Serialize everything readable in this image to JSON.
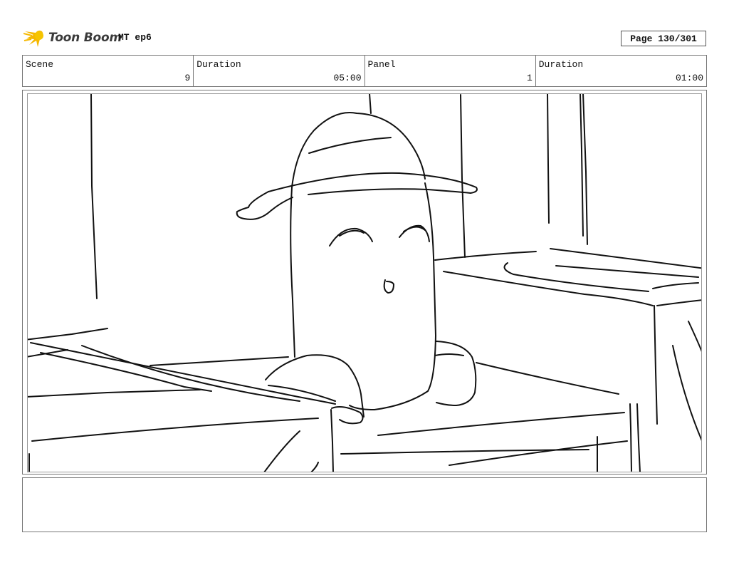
{
  "header": {
    "logo_text": "Toon Boom",
    "project": "MT ep6",
    "page": "Page 130/301"
  },
  "info": {
    "scene_label": "Scene",
    "scene_value": "9",
    "scene_duration_label": "Duration",
    "scene_duration_value": "05:00",
    "panel_label": "Panel",
    "panel_value": "1",
    "panel_duration_label": "Duration",
    "panel_duration_value": "01:00"
  },
  "notes": {
    "text": ""
  },
  "colors": {
    "logo_accent": "#f5b800",
    "logo_text": "#3a3a3a",
    "border": "#777777"
  },
  "icons": {
    "logo": "toon-boom-star-icon"
  }
}
